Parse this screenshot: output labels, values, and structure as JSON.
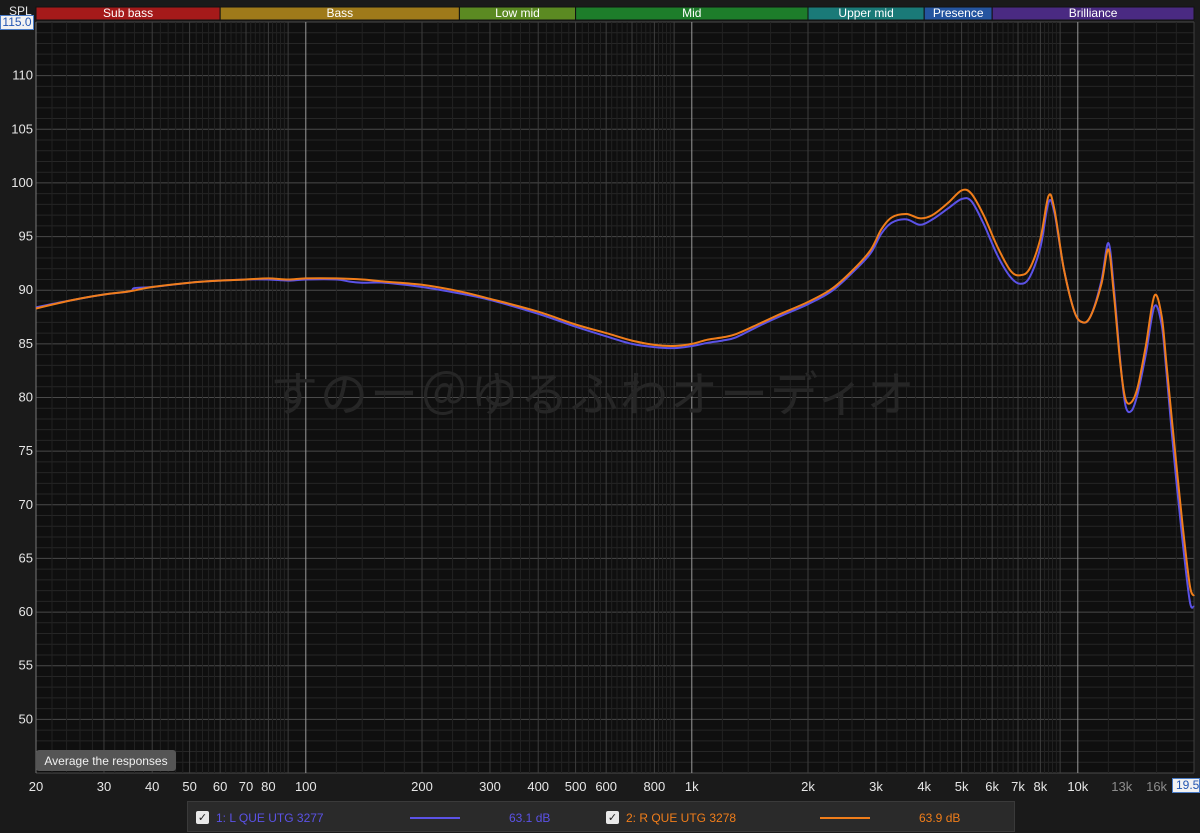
{
  "watermark": "すのー＠ゆるふわオーディオ",
  "y_axis_title": "SPL",
  "y_top_value": "115.0",
  "x_right_value": "19.5",
  "average_button_label": "Average the responses",
  "bands": [
    {
      "label": "Sub bass",
      "from": 20,
      "to": 60,
      "color": "#a51a1a"
    },
    {
      "label": "Bass",
      "from": 60,
      "to": 250,
      "color": "#9f7a1a"
    },
    {
      "label": "Low mid",
      "from": 250,
      "to": 500,
      "color": "#5b8a22"
    },
    {
      "label": "Mid",
      "from": 500,
      "to": 2000,
      "color": "#1d7d2a"
    },
    {
      "label": "Upper mid",
      "from": 2000,
      "to": 4000,
      "color": "#1a7a78"
    },
    {
      "label": "Presence",
      "from": 4000,
      "to": 6000,
      "color": "#2555a0"
    },
    {
      "label": "Brilliance",
      "from": 6000,
      "to": 20000,
      "color": "#4a2a82"
    }
  ],
  "legend": [
    {
      "label": "1: L QUE UTG 3277",
      "value": "63.1 dB",
      "color": "#5b52e6",
      "checked": "✓"
    },
    {
      "label": "2: R QUE UTG 3278",
      "value": "63.9 dB",
      "color": "#f07d1a",
      "checked": "✓"
    }
  ],
  "chart_data": {
    "type": "line",
    "xlabel": "",
    "ylabel": "SPL",
    "xscale": "log",
    "xlim": [
      20,
      20000
    ],
    "ylim": [
      45,
      115
    ],
    "grid": true,
    "y_ticks": [
      50,
      55,
      60,
      65,
      70,
      75,
      80,
      85,
      90,
      95,
      100,
      105,
      110
    ],
    "x_ticks": [
      {
        "v": 20,
        "t": "20"
      },
      {
        "v": 30,
        "t": "30"
      },
      {
        "v": 40,
        "t": "40"
      },
      {
        "v": 50,
        "t": "50"
      },
      {
        "v": 60,
        "t": "60"
      },
      {
        "v": 70,
        "t": "70"
      },
      {
        "v": 80,
        "t": "80"
      },
      {
        "v": 100,
        "t": "100"
      },
      {
        "v": 200,
        "t": "200"
      },
      {
        "v": 300,
        "t": "300"
      },
      {
        "v": 400,
        "t": "400"
      },
      {
        "v": 500,
        "t": "500"
      },
      {
        "v": 600,
        "t": "600"
      },
      {
        "v": 800,
        "t": "800"
      },
      {
        "v": 1000,
        "t": "1k"
      },
      {
        "v": 2000,
        "t": "2k"
      },
      {
        "v": 3000,
        "t": "3k"
      },
      {
        "v": 4000,
        "t": "4k"
      },
      {
        "v": 5000,
        "t": "5k"
      },
      {
        "v": 6000,
        "t": "6k"
      },
      {
        "v": 7000,
        "t": "7k"
      },
      {
        "v": 8000,
        "t": "8k"
      },
      {
        "v": 10000,
        "t": "10k"
      },
      {
        "v": 13000,
        "t": "13k"
      },
      {
        "v": 16000,
        "t": "16k"
      }
    ],
    "series": [
      {
        "name": "1: L QUE UTG 3277",
        "color": "#5b52e6",
        "points": [
          [
            20,
            88.4
          ],
          [
            25,
            89.1
          ],
          [
            30,
            89.6
          ],
          [
            35,
            89.9
          ],
          [
            36,
            90.2
          ],
          [
            40,
            90.3
          ],
          [
            50,
            90.7
          ],
          [
            60,
            90.9
          ],
          [
            70,
            91.0
          ],
          [
            80,
            91.0
          ],
          [
            90,
            90.9
          ],
          [
            100,
            91.0
          ],
          [
            120,
            91.0
          ],
          [
            130,
            90.8
          ],
          [
            140,
            90.7
          ],
          [
            160,
            90.7
          ],
          [
            200,
            90.3
          ],
          [
            250,
            89.7
          ],
          [
            300,
            89.1
          ],
          [
            400,
            87.8
          ],
          [
            500,
            86.6
          ],
          [
            600,
            85.7
          ],
          [
            700,
            85.0
          ],
          [
            800,
            84.7
          ],
          [
            900,
            84.6
          ],
          [
            1000,
            84.8
          ],
          [
            1100,
            85.1
          ],
          [
            1200,
            85.3
          ],
          [
            1300,
            85.6
          ],
          [
            1500,
            86.7
          ],
          [
            1700,
            87.6
          ],
          [
            2000,
            88.7
          ],
          [
            2300,
            89.9
          ],
          [
            2600,
            91.6
          ],
          [
            2900,
            93.4
          ],
          [
            3100,
            95.3
          ],
          [
            3300,
            96.3
          ],
          [
            3600,
            96.6
          ],
          [
            3900,
            96.1
          ],
          [
            4200,
            96.6
          ],
          [
            4600,
            97.6
          ],
          [
            5000,
            98.5
          ],
          [
            5300,
            98.3
          ],
          [
            5700,
            96.2
          ],
          [
            6200,
            93.2
          ],
          [
            6700,
            91.2
          ],
          [
            7100,
            90.6
          ],
          [
            7500,
            91.2
          ],
          [
            8000,
            94.0
          ],
          [
            8400,
            98.2
          ],
          [
            8700,
            97.2
          ],
          [
            9200,
            92.0
          ],
          [
            9800,
            88.0
          ],
          [
            10300,
            87.0
          ],
          [
            10800,
            87.6
          ],
          [
            11500,
            90.8
          ],
          [
            12000,
            94.4
          ],
          [
            12400,
            90.2
          ],
          [
            12900,
            83.2
          ],
          [
            13300,
            79.2
          ],
          [
            13800,
            78.8
          ],
          [
            14300,
            80.4
          ],
          [
            15000,
            84.0
          ],
          [
            15800,
            88.5
          ],
          [
            16500,
            86.7
          ],
          [
            17000,
            82.0
          ],
          [
            17800,
            74.0
          ],
          [
            18700,
            66.5
          ],
          [
            19500,
            61.0
          ],
          [
            20000,
            60.5
          ]
        ]
      },
      {
        "name": "2: R QUE UTG 3278",
        "color": "#f07d1a",
        "points": [
          [
            20,
            88.3
          ],
          [
            25,
            89.1
          ],
          [
            30,
            89.6
          ],
          [
            35,
            89.9
          ],
          [
            40,
            90.3
          ],
          [
            50,
            90.7
          ],
          [
            60,
            90.9
          ],
          [
            70,
            91.0
          ],
          [
            80,
            91.1
          ],
          [
            90,
            91.0
          ],
          [
            100,
            91.1
          ],
          [
            120,
            91.1
          ],
          [
            140,
            91.0
          ],
          [
            160,
            90.8
          ],
          [
            200,
            90.5
          ],
          [
            250,
            89.9
          ],
          [
            300,
            89.2
          ],
          [
            400,
            88.0
          ],
          [
            500,
            86.8
          ],
          [
            600,
            86.0
          ],
          [
            700,
            85.3
          ],
          [
            800,
            84.9
          ],
          [
            900,
            84.8
          ],
          [
            1000,
            85.0
          ],
          [
            1100,
            85.4
          ],
          [
            1200,
            85.6
          ],
          [
            1300,
            85.9
          ],
          [
            1500,
            86.9
          ],
          [
            1700,
            87.8
          ],
          [
            2000,
            88.9
          ],
          [
            2300,
            90.1
          ],
          [
            2600,
            91.8
          ],
          [
            2900,
            93.7
          ],
          [
            3100,
            95.7
          ],
          [
            3300,
            96.8
          ],
          [
            3600,
            97.1
          ],
          [
            3900,
            96.7
          ],
          [
            4200,
            97.0
          ],
          [
            4600,
            98.1
          ],
          [
            5000,
            99.3
          ],
          [
            5300,
            99.0
          ],
          [
            5700,
            97.0
          ],
          [
            6200,
            94.0
          ],
          [
            6700,
            91.8
          ],
          [
            7100,
            91.4
          ],
          [
            7500,
            92.0
          ],
          [
            8000,
            94.8
          ],
          [
            8400,
            98.8
          ],
          [
            8700,
            97.5
          ],
          [
            9200,
            92.0
          ],
          [
            9800,
            88.0
          ],
          [
            10300,
            87.0
          ],
          [
            10800,
            87.6
          ],
          [
            11500,
            90.5
          ],
          [
            12000,
            93.8
          ],
          [
            12400,
            89.6
          ],
          [
            12900,
            83.0
          ],
          [
            13300,
            79.8
          ],
          [
            13800,
            79.6
          ],
          [
            14300,
            81.0
          ],
          [
            15000,
            84.8
          ],
          [
            15800,
            89.5
          ],
          [
            16500,
            87.5
          ],
          [
            17000,
            82.8
          ],
          [
            17800,
            75.5
          ],
          [
            18700,
            68.0
          ],
          [
            19500,
            62.5
          ],
          [
            20000,
            61.5
          ]
        ]
      }
    ]
  }
}
